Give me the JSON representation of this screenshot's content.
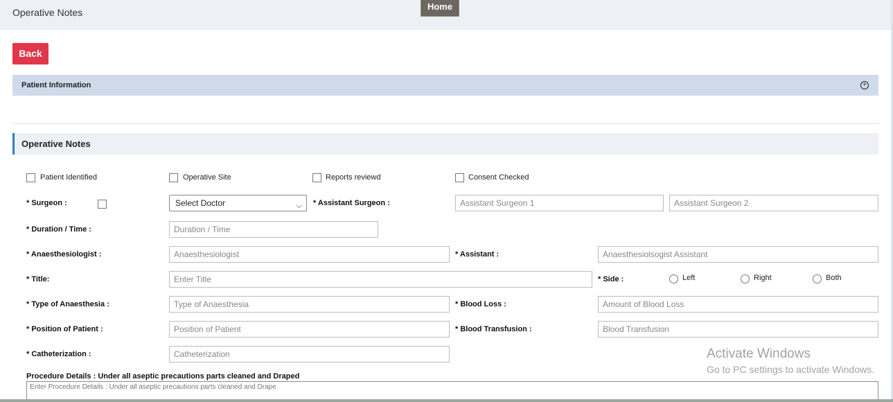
{
  "header": {
    "title": "Operative Notes",
    "home_label": "Home"
  },
  "back_label": "Back",
  "patient_panel": {
    "title": "Patient Information",
    "expand_icon": "plus-circle-icon"
  },
  "section": {
    "title": "Operative Notes"
  },
  "checkboxes": {
    "patient_identified": "Patient Identified",
    "operative_site": "Operative Site",
    "reports_reviewed": "Reports reviewd",
    "consent_checked": "Consent Checked"
  },
  "form": {
    "surgeon_label": "* Surgeon :",
    "surgeon_select_value": "Select Doctor",
    "assistant_surgeon_label": "* Assistant Surgeon :",
    "assistant_surgeon_1_placeholder": "Assistant Surgeon 1",
    "assistant_surgeon_2_placeholder": "Assistant Surgeon 2",
    "duration_label": "* Duration / Time :",
    "duration_placeholder": "Duration / Time",
    "anaesthesiologist_label": "* Anaesthesiologist :",
    "anaesthesiologist_placeholder": "Anaesthesiologist",
    "assistant_label": "* Assistant :",
    "assistant_placeholder": "Anaesthesiolsogist Assistant",
    "title_label": "* Title:",
    "title_placeholder": "Enter Title",
    "side_label": "* Side :",
    "side_options": [
      "Left",
      "Right",
      "Both"
    ],
    "type_anaesthesia_label": "* Type of Anaesthesia :",
    "type_anaesthesia_placeholder": "Type of Anaesthesia",
    "blood_loss_label": "* Blood Loss :",
    "blood_loss_placeholder": "Amount of Blood Loss",
    "position_label": "* Position of Patient :",
    "position_placeholder": "Position of Patient",
    "blood_transfusion_label": "* Blood Transfusion :",
    "blood_transfusion_placeholder": "Blood Transfusion",
    "catheterization_label": "* Catheterization :",
    "catheterization_placeholder": "Catheterization",
    "procedure_label": "Procedure Details : Under all aseptic precautions parts cleaned and Draped",
    "procedure_placeholder": "Enter Procedure Details : Under all aseptic precautions parts cleaned and Drape"
  },
  "watermark": {
    "line1": "Activate Windows",
    "line2": "Go to PC settings to activate Windows."
  },
  "colors": {
    "back_button": "#e0374a",
    "panel_bar": "#cfdaea",
    "section_accent": "#2f7fc4",
    "home_button": "#6e6660"
  }
}
